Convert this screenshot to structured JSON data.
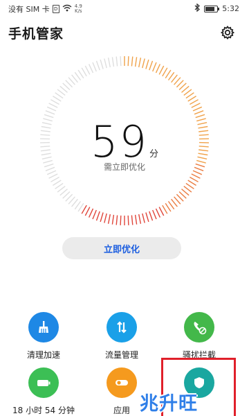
{
  "status_bar": {
    "carrier": "没有 SIM 卡",
    "net_speed_value": "4.9",
    "net_speed_unit": "K/s",
    "time": "5:32",
    "battery_level": 0.9
  },
  "header": {
    "title": "手机管家"
  },
  "score": {
    "value": "59",
    "unit": "分",
    "subtitle": "需立即优化"
  },
  "optimize_button": "立即优化",
  "tools": [
    {
      "label": "清理加速",
      "color": "#1e88e5",
      "icon": "broom-icon"
    },
    {
      "label": "流量管理",
      "color": "#1aa0e8",
      "icon": "data-arrows-icon"
    },
    {
      "label": "骚扰拦截",
      "color": "#43b84a",
      "icon": "phone-block-icon"
    },
    {
      "label": "18 小时 54 分钟",
      "color": "#3cbf55",
      "icon": "battery-icon"
    },
    {
      "label": "应用",
      "color": "#f59a1e",
      "icon": "app-toggle-icon"
    },
    {
      "label": "",
      "color": "#1aa7a0",
      "icon": "shield-icon"
    }
  ],
  "watermark": "兆升旺",
  "colors": {
    "accent_blue": "#1d5fe0",
    "gauge_orange": "#f0a24a",
    "gauge_red": "#e0453a",
    "gauge_gray": "#dedede",
    "highlight_red": "#e0202a"
  }
}
